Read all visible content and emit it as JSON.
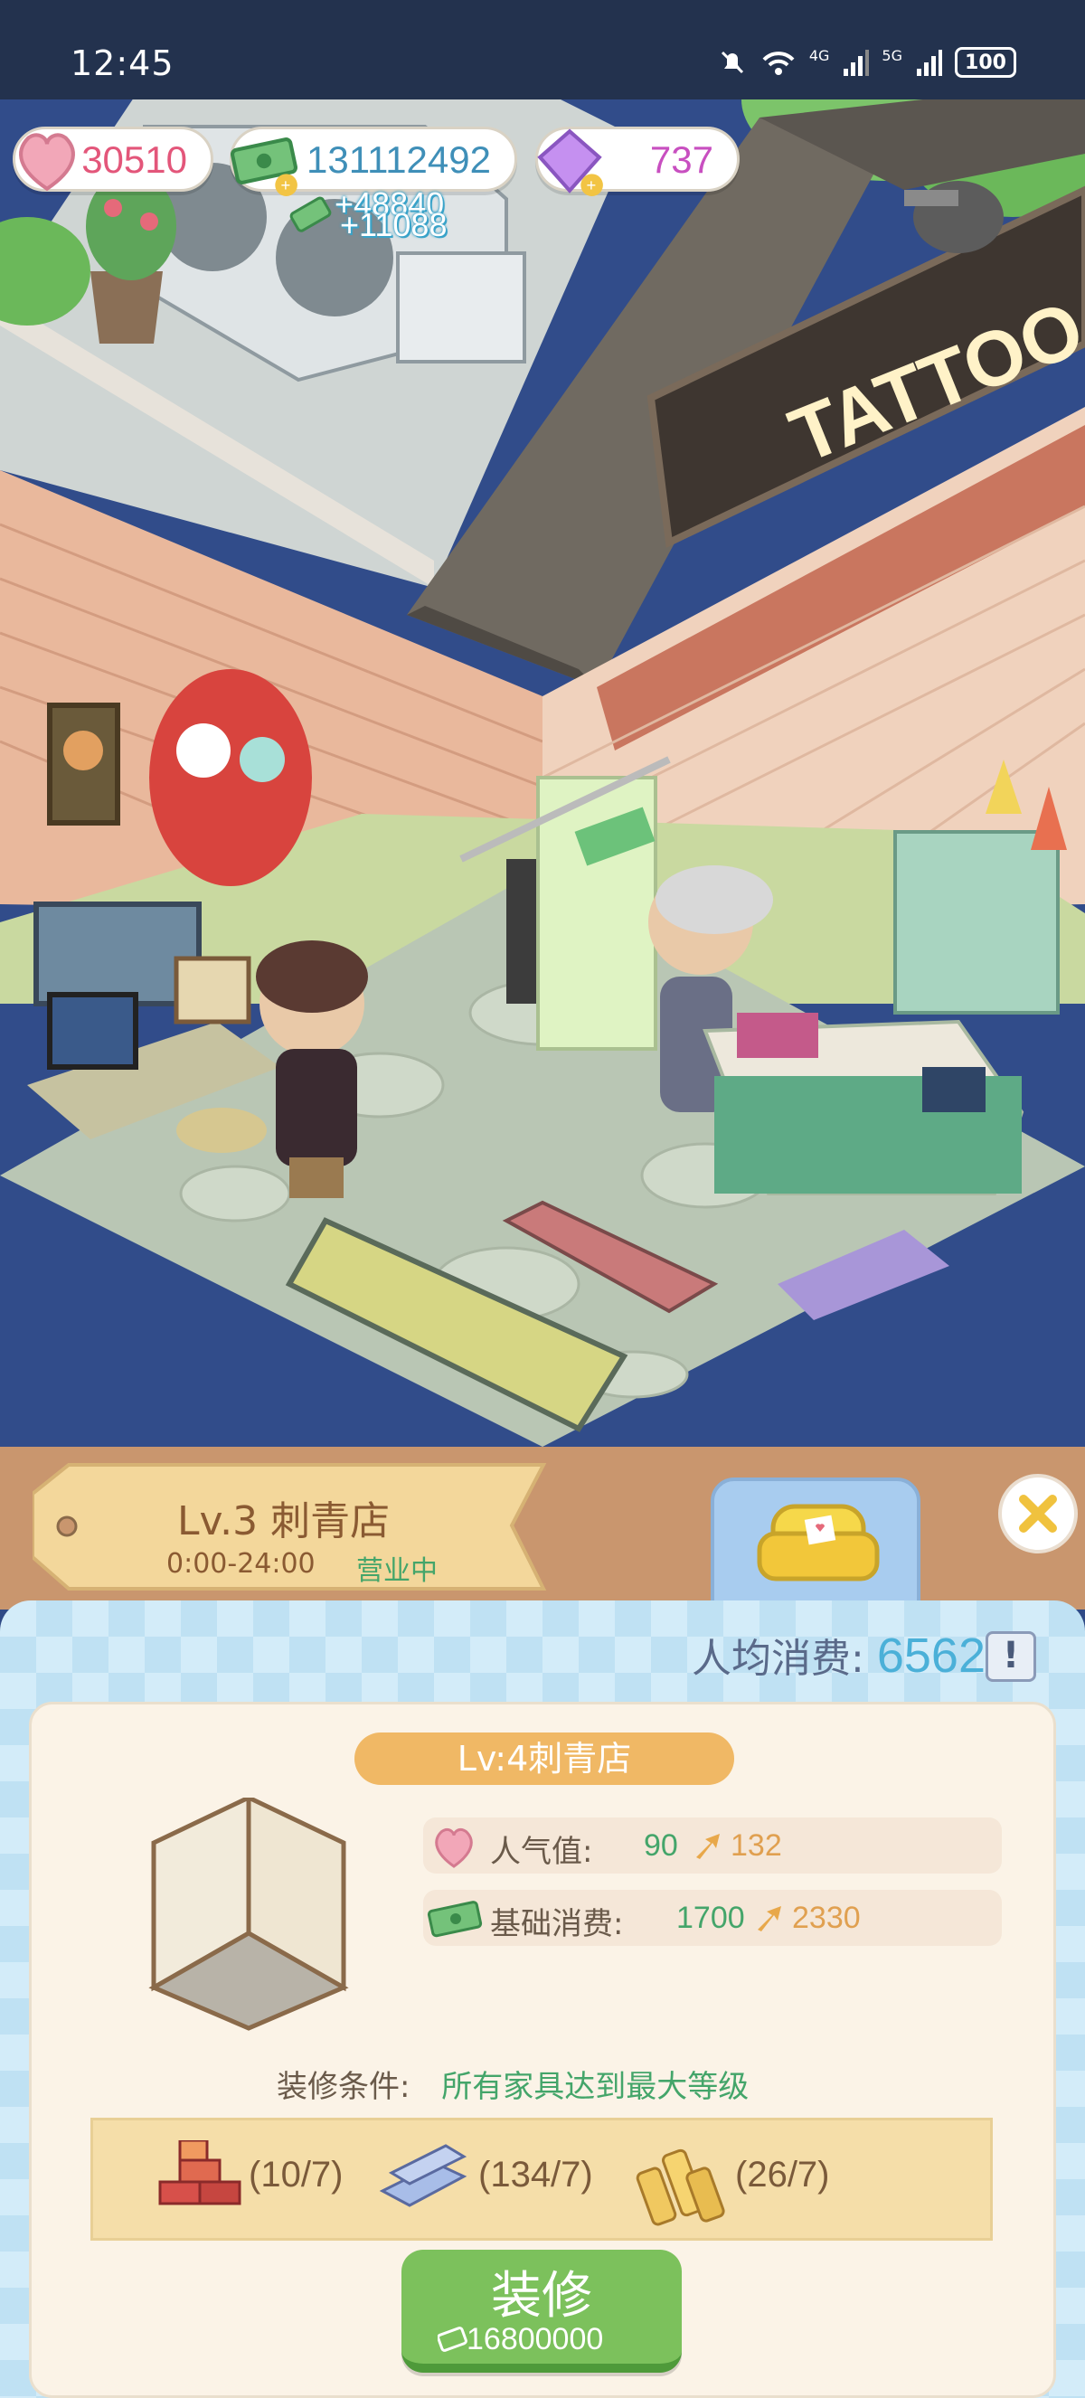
{
  "status_bar": {
    "time": "12:45",
    "net1": "4G",
    "net2": "5G",
    "battery": "100"
  },
  "resources": {
    "hearts": "30510",
    "cash": "131112492",
    "gems": "737",
    "cash_gain_1": "+48840",
    "cash_gain_2": "+11088"
  },
  "scene": {
    "sign_text": "TATTOO"
  },
  "shop_tag": {
    "level_name": "Lv.3 刺青店",
    "hours": "0:00-24:00",
    "status": "营业中"
  },
  "avg_spend": {
    "label": "人均消费:",
    "value": "6562",
    "info": "!"
  },
  "upgrade": {
    "next_level": "Lv:4刺青店",
    "popularity_label": "人气值:",
    "popularity_from": "90",
    "popularity_to": "132",
    "base_label": "基础消费:",
    "base_from": "1700",
    "base_to": "2330",
    "condition_label": "装修条件:",
    "condition_value": "所有家具达到最大等级",
    "materials": [
      {
        "name": "bricks",
        "count": "(10/7)"
      },
      {
        "name": "steel",
        "count": "(134/7)"
      },
      {
        "name": "wood",
        "count": "(26/7)"
      }
    ],
    "button_label": "装修",
    "button_cost": "16800000"
  },
  "colors": {
    "accent_green": "#44a56a",
    "accent_blue": "#4bb0d8",
    "button_green": "#7cc15c",
    "ribbon_orange": "#f0b865"
  }
}
